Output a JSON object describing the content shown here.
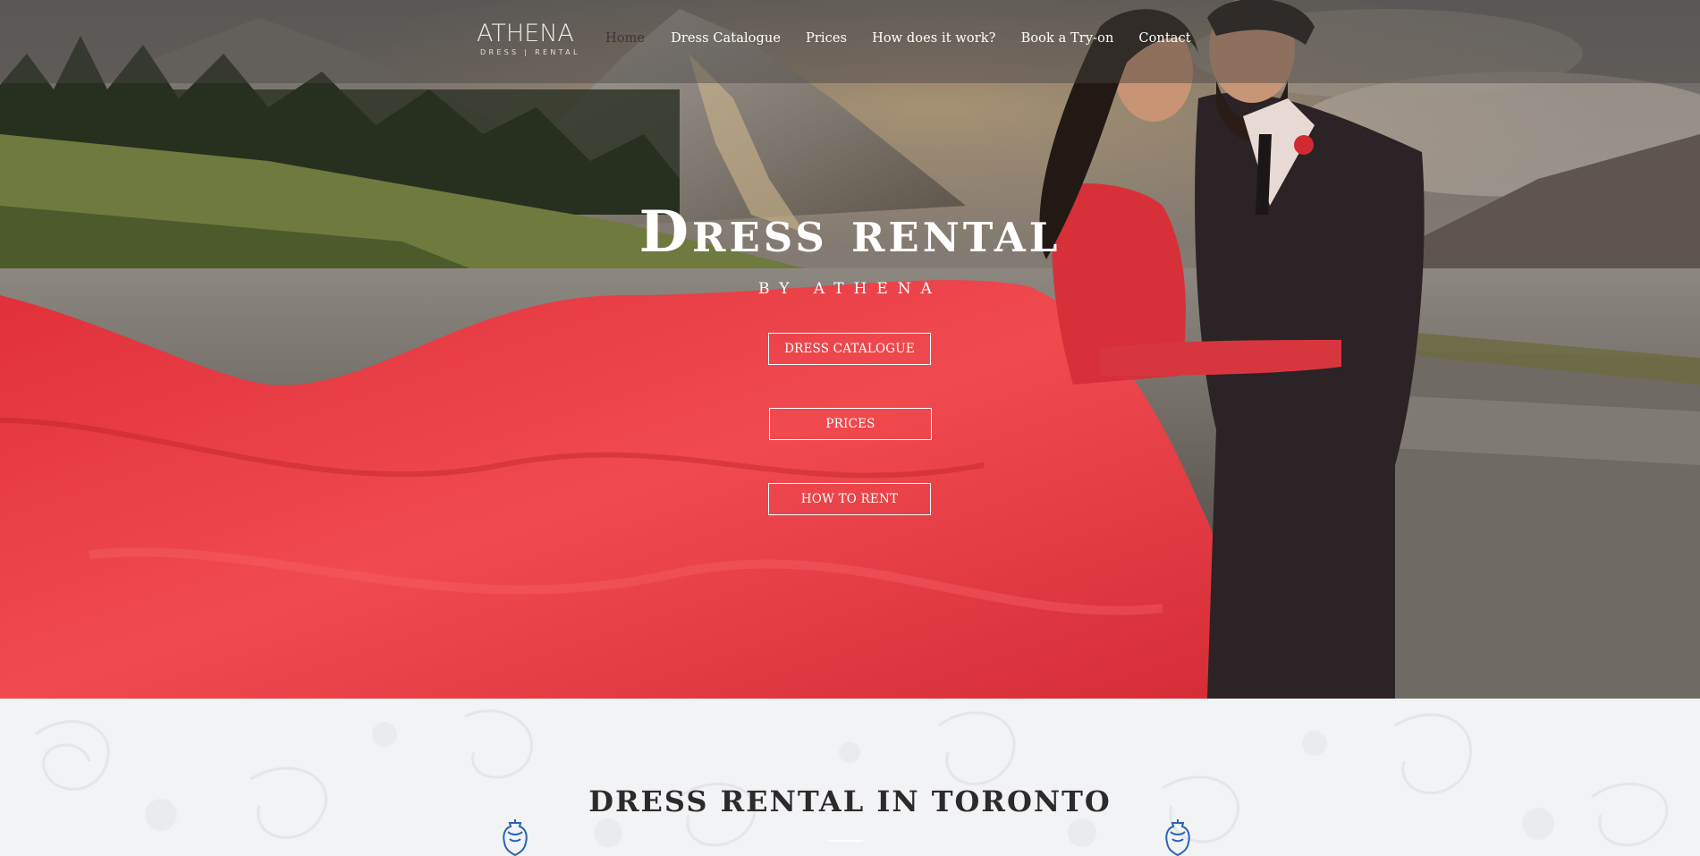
{
  "brand": {
    "logo_main": "ATHENA",
    "logo_sub": "DRESS | RENTAL"
  },
  "nav": {
    "items": [
      {
        "label": "Home",
        "active": true
      },
      {
        "label": "Dress Catalogue",
        "active": false
      },
      {
        "label": "Prices",
        "active": false
      },
      {
        "label": "How does it work?",
        "active": false
      },
      {
        "label": "Book a Try-on",
        "active": false
      },
      {
        "label": "Contact",
        "active": false
      }
    ]
  },
  "hero": {
    "title": "Dress rental",
    "subtitle": "by athena",
    "buttons": {
      "catalogue": "DRESS CATALOGUE",
      "prices": "PRICES",
      "how_to_rent": "HOW TO RENT"
    }
  },
  "section": {
    "title": "DRESS RENTAL IN TORONTO"
  },
  "colors": {
    "dress_red": "#e8353d",
    "nav_active": "#3a3633",
    "mannequin_blue": "#2a64b4",
    "section_bg": "#f2f3f5"
  },
  "icons": [
    "mannequin-icon"
  ]
}
